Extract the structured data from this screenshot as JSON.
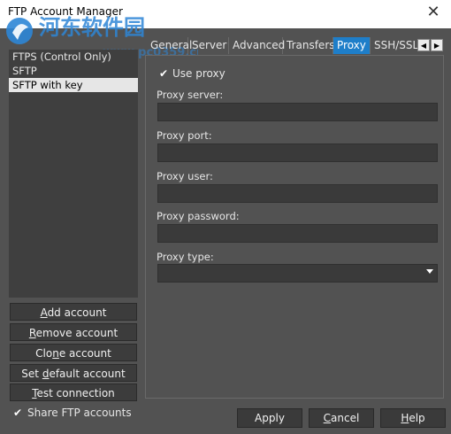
{
  "window": {
    "title": "FTP Account Manager",
    "close_glyph": "✕"
  },
  "watermark": {
    "line1": "河东软件园",
    "line2": "www.pc0359.cn"
  },
  "accounts": [
    {
      "label": "FTPS (Control Only)",
      "selected": false
    },
    {
      "label": "SFTP",
      "selected": false
    },
    {
      "label": "SFTP with key",
      "selected": true
    }
  ],
  "side_buttons": {
    "add": {
      "pre": "",
      "ul": "A",
      "post": "dd account"
    },
    "remove": {
      "pre": "",
      "ul": "R",
      "post": "emove account"
    },
    "clone": {
      "pre": "Clo",
      "ul": "n",
      "post": "e account"
    },
    "set_default": {
      "pre": "Set ",
      "ul": "d",
      "post": "efault account"
    },
    "test": {
      "pre": "",
      "ul": "T",
      "post": "est connection"
    }
  },
  "share": {
    "label": "Share FTP accounts",
    "checked": true
  },
  "tabs": [
    "General",
    "Server",
    "Advanced",
    "Transfers",
    "Proxy",
    "SSH/SSL"
  ],
  "active_tab": "Proxy",
  "proxy": {
    "use_proxy_label": "Use proxy",
    "use_proxy_checked": true,
    "server_label": "Proxy server:",
    "server_value": "",
    "port_label": "Proxy port:",
    "port_value": "",
    "user_label": "Proxy user:",
    "user_value": "",
    "password_label": "Proxy password:",
    "password_value": "",
    "type_label": "Proxy type:",
    "type_value": ""
  },
  "bottom": {
    "apply": "Apply",
    "cancel": {
      "pre": "",
      "ul": "C",
      "post": "ancel"
    },
    "help": {
      "pre": "",
      "ul": "H",
      "post": "elp"
    }
  },
  "colors": {
    "background": "#525252",
    "active_tab": "#1e7ec9",
    "input": "#3a3a3a",
    "list": "#3f3f3f"
  }
}
